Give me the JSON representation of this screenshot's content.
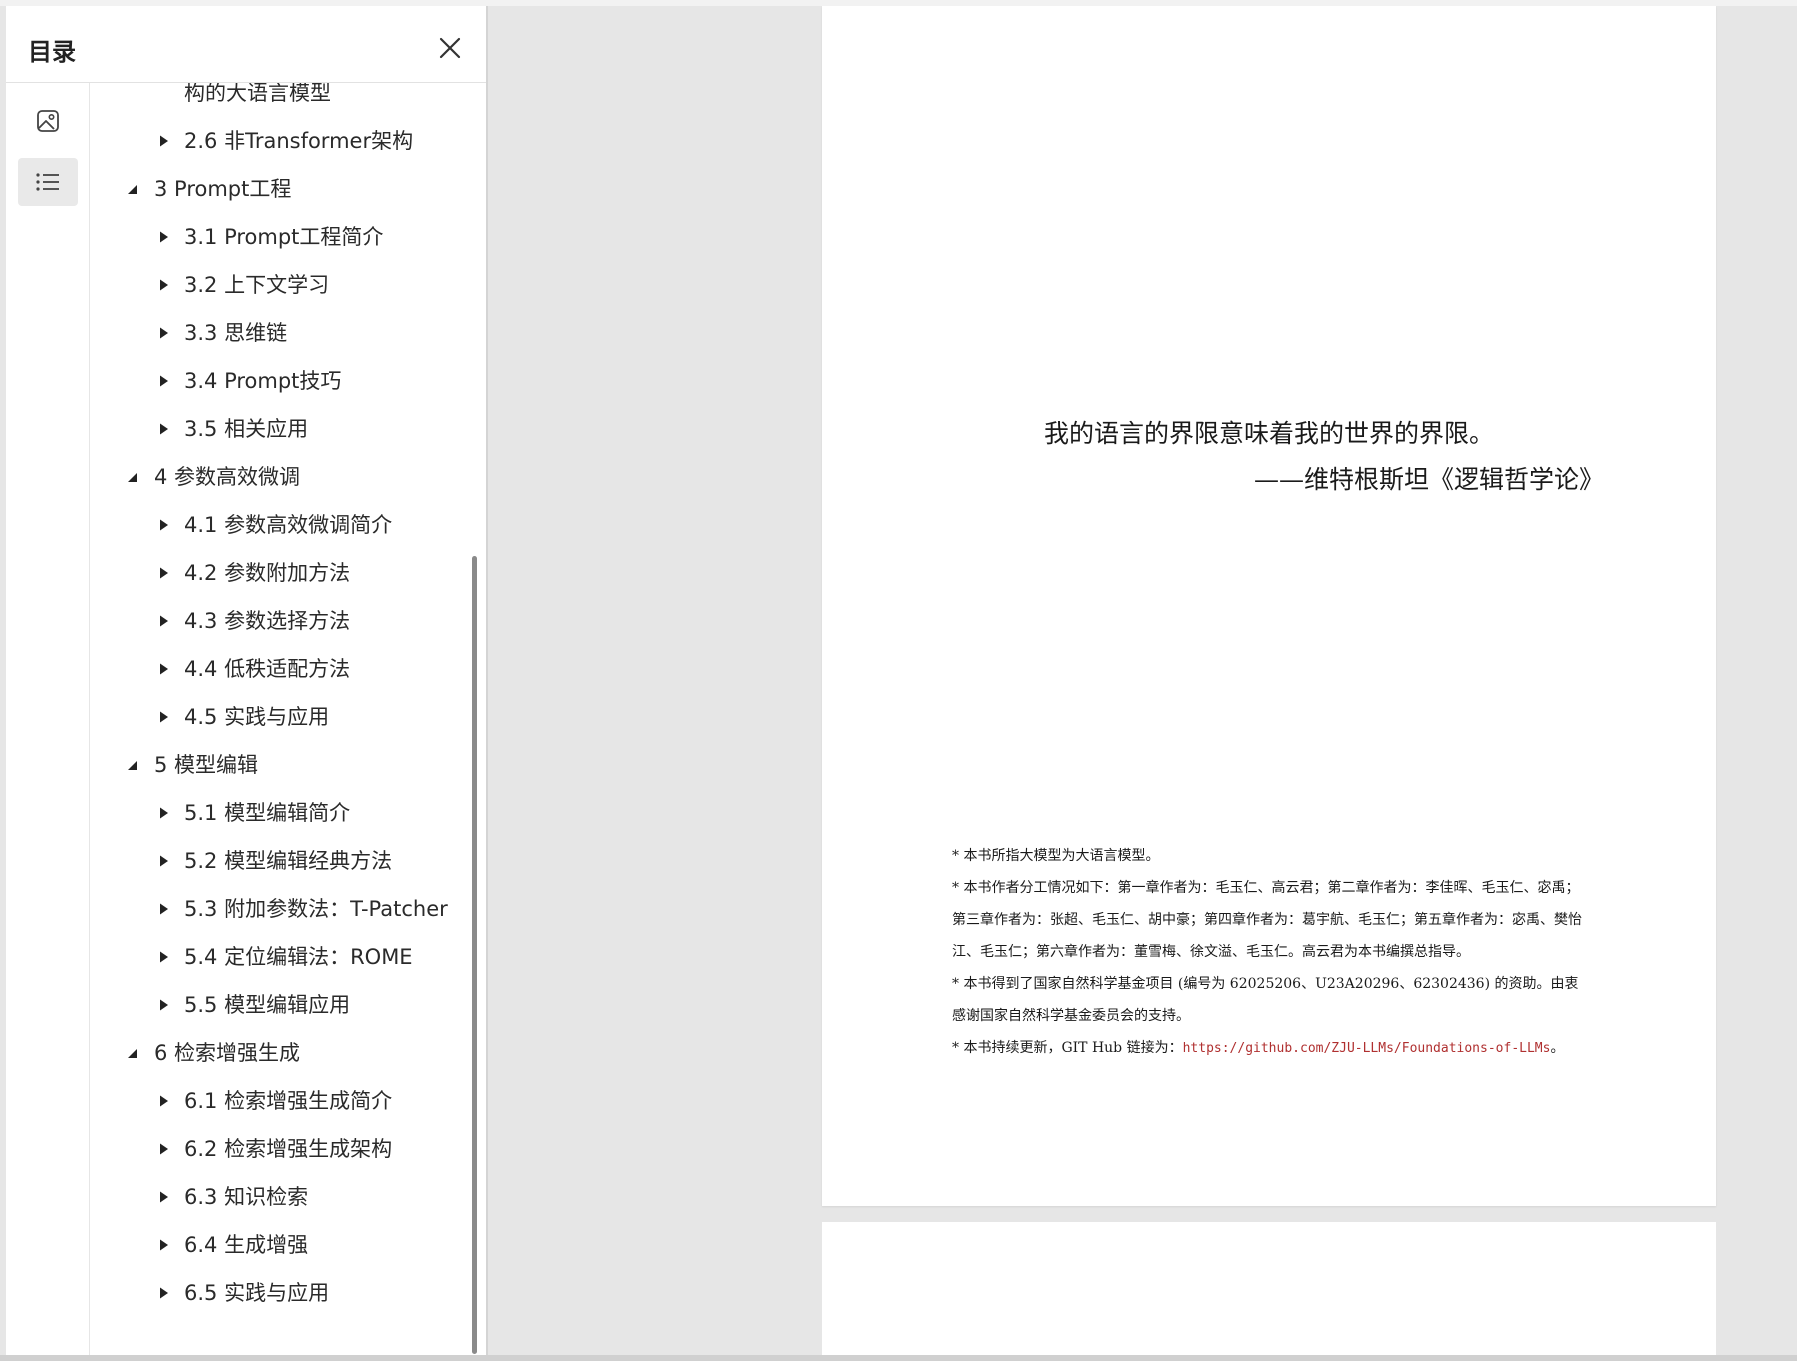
{
  "sidebar": {
    "title": "目录",
    "close_icon": "close-icon",
    "rail": [
      {
        "icon": "image-thumbnails-icon",
        "active": false
      },
      {
        "icon": "list-outline-icon",
        "active": true
      }
    ],
    "toc": [
      {
        "level": 2,
        "label": "构的大语言模型",
        "expanded": null
      },
      {
        "level": 2,
        "label": "2.6 非Transformer架构",
        "expanded": false
      },
      {
        "level": 1,
        "label": "3 Prompt工程",
        "expanded": true
      },
      {
        "level": 2,
        "label": "3.1 Prompt工程简介",
        "expanded": false
      },
      {
        "level": 2,
        "label": "3.2 上下文学习",
        "expanded": false
      },
      {
        "level": 2,
        "label": "3.3 思维链",
        "expanded": false
      },
      {
        "level": 2,
        "label": "3.4 Prompt技巧",
        "expanded": false
      },
      {
        "level": 2,
        "label": "3.5 相关应用",
        "expanded": false
      },
      {
        "level": 1,
        "label": "4 参数高效微调",
        "expanded": true
      },
      {
        "level": 2,
        "label": "4.1 参数高效微调简介",
        "expanded": false
      },
      {
        "level": 2,
        "label": "4.2 参数附加方法",
        "expanded": false
      },
      {
        "level": 2,
        "label": "4.3 参数选择方法",
        "expanded": false
      },
      {
        "level": 2,
        "label": "4.4 低秩适配方法",
        "expanded": false
      },
      {
        "level": 2,
        "label": "4.5 实践与应用",
        "expanded": false
      },
      {
        "level": 1,
        "label": "5 模型编辑",
        "expanded": true
      },
      {
        "level": 2,
        "label": "5.1 模型编辑简介",
        "expanded": false
      },
      {
        "level": 2,
        "label": "5.2 模型编辑经典方法",
        "expanded": false
      },
      {
        "level": 2,
        "label": "5.3 附加参数法：T-Patcher",
        "expanded": false
      },
      {
        "level": 2,
        "label": "5.4 定位编辑法：ROME",
        "expanded": false
      },
      {
        "level": 2,
        "label": "5.5 模型编辑应用",
        "expanded": false
      },
      {
        "level": 1,
        "label": "6 检索增强生成",
        "expanded": true
      },
      {
        "level": 2,
        "label": "6.1 检索增强生成简介",
        "expanded": false
      },
      {
        "level": 2,
        "label": "6.2 检索增强生成架构",
        "expanded": false
      },
      {
        "level": 2,
        "label": "6.3 知识检索",
        "expanded": false
      },
      {
        "level": 2,
        "label": "6.4 生成增强",
        "expanded": false
      },
      {
        "level": 2,
        "label": "6.5 实践与应用",
        "expanded": false
      }
    ]
  },
  "page": {
    "quote_line1": "我的语言的界限意味着我的世界的界限。",
    "quote_line2": "——维特根斯坦《逻辑哲学论》",
    "footnote1": "* 本书所指大模型为大语言模型。",
    "footnote2": "* 本书作者分工情况如下：第一章作者为：毛玉仁、高云君；第二章作者为：李佳晖、毛玉仁、宓禹；第三章作者为：张超、毛玉仁、胡中豪；第四章作者为：葛宇航、毛玉仁；第五章作者为：宓禹、樊怡江、毛玉仁；第六章作者为：董雪梅、徐文溢、毛玉仁。高云君为本书编撰总指导。",
    "footnote3": "* 本书得到了国家自然科学基金项目 (编号为 62025206、U23A20296、62302436) 的资助。由衷感谢国家自然科学基金委员会的支持。",
    "footnote4_prefix": "* 本书持续更新，GIT Hub 链接为：",
    "footnote4_link": "https://github.com/ZJU-LLMs/Foundations-of-LLMs",
    "footnote4_suffix": "。"
  }
}
